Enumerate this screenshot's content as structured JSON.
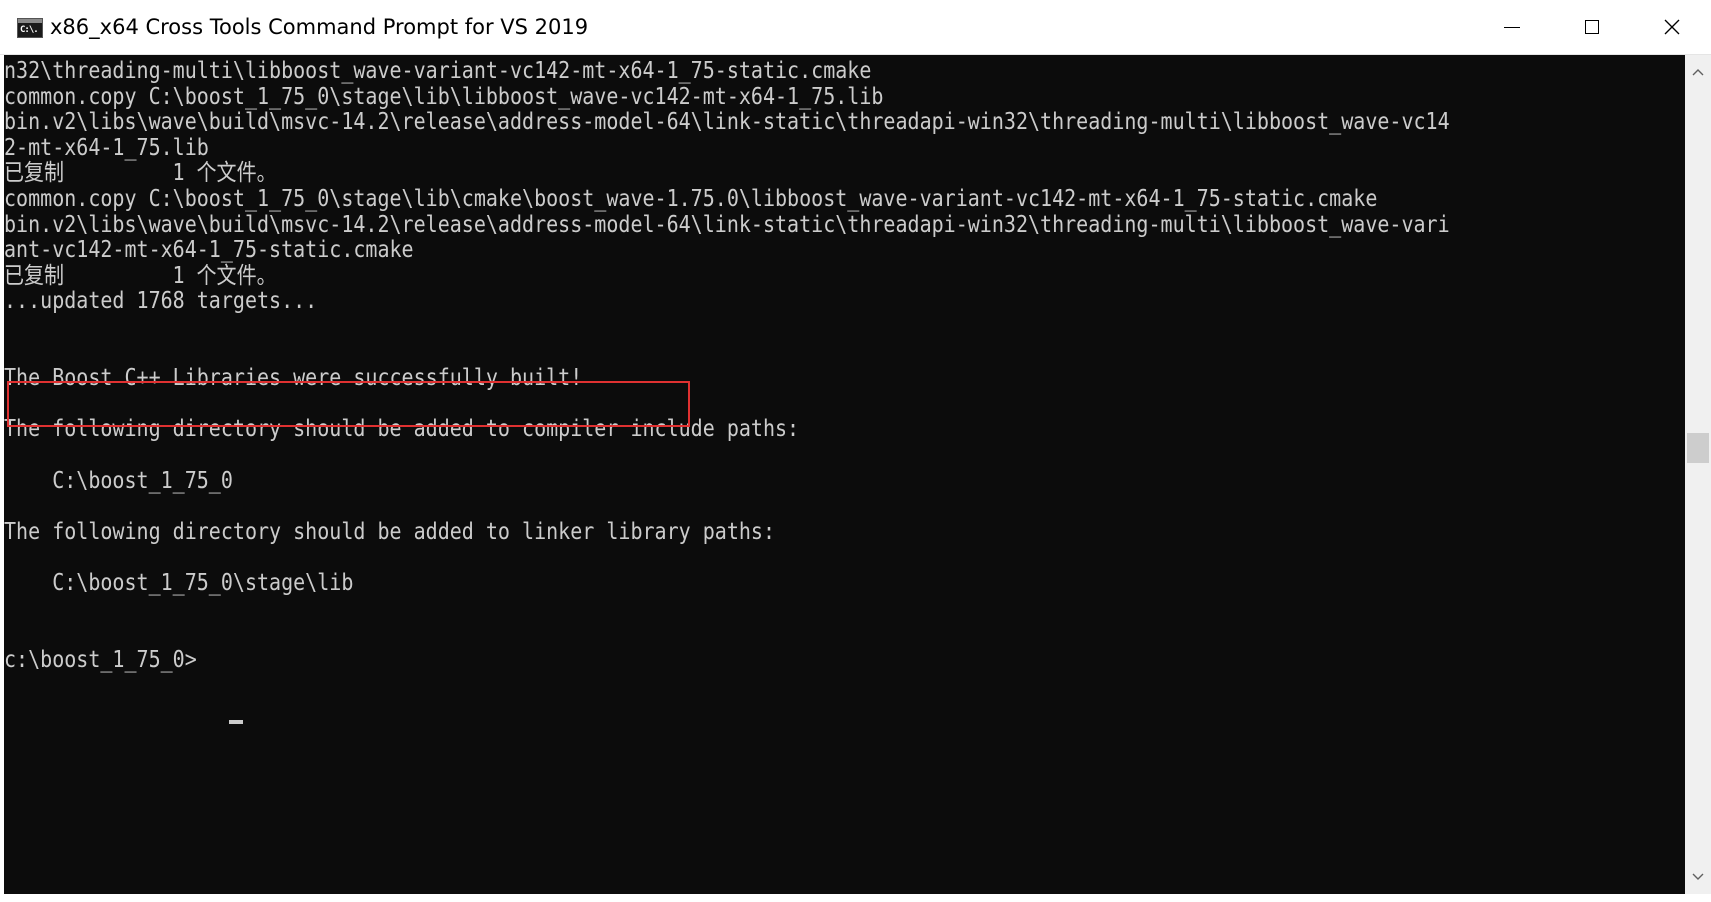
{
  "window": {
    "title": "x86_x64 Cross Tools Command Prompt for VS 2019",
    "icon_name": "console-icon",
    "icon_text": "C:\\."
  },
  "console": {
    "background_color": "#0c0c0c",
    "text_color": "#cccccc",
    "highlight_color": "#e03131",
    "lines": [
      "n32\\threading-multi\\libboost_wave-variant-vc142-mt-x64-1_75-static.cmake",
      "common.copy C:\\boost_1_75_0\\stage\\lib\\libboost_wave-vc142-mt-x64-1_75.lib",
      "bin.v2\\libs\\wave\\build\\msvc-14.2\\release\\address-model-64\\link-static\\threadapi-win32\\threading-multi\\libboost_wave-vc14",
      "2-mt-x64-1_75.lib",
      "已复制         1 个文件。",
      "common.copy C:\\boost_1_75_0\\stage\\lib\\cmake\\boost_wave-1.75.0\\libboost_wave-variant-vc142-mt-x64-1_75-static.cmake",
      "bin.v2\\libs\\wave\\build\\msvc-14.2\\release\\address-model-64\\link-static\\threadapi-win32\\threading-multi\\libboost_wave-vari",
      "ant-vc142-mt-x64-1_75-static.cmake",
      "已复制         1 个文件。",
      "...updated 1768 targets...",
      "",
      "",
      "The Boost C++ Libraries were successfully built!",
      "",
      "The following directory should be added to compiler include paths:",
      "",
      "    C:\\boost_1_75_0",
      "",
      "The following directory should be added to linker library paths:",
      "",
      "    C:\\boost_1_75_0\\stage\\lib",
      "",
      "",
      "c:\\boost_1_75_0>"
    ]
  },
  "controls": {
    "minimize": "minimize-icon",
    "maximize": "maximize-icon",
    "close": "close-icon"
  }
}
